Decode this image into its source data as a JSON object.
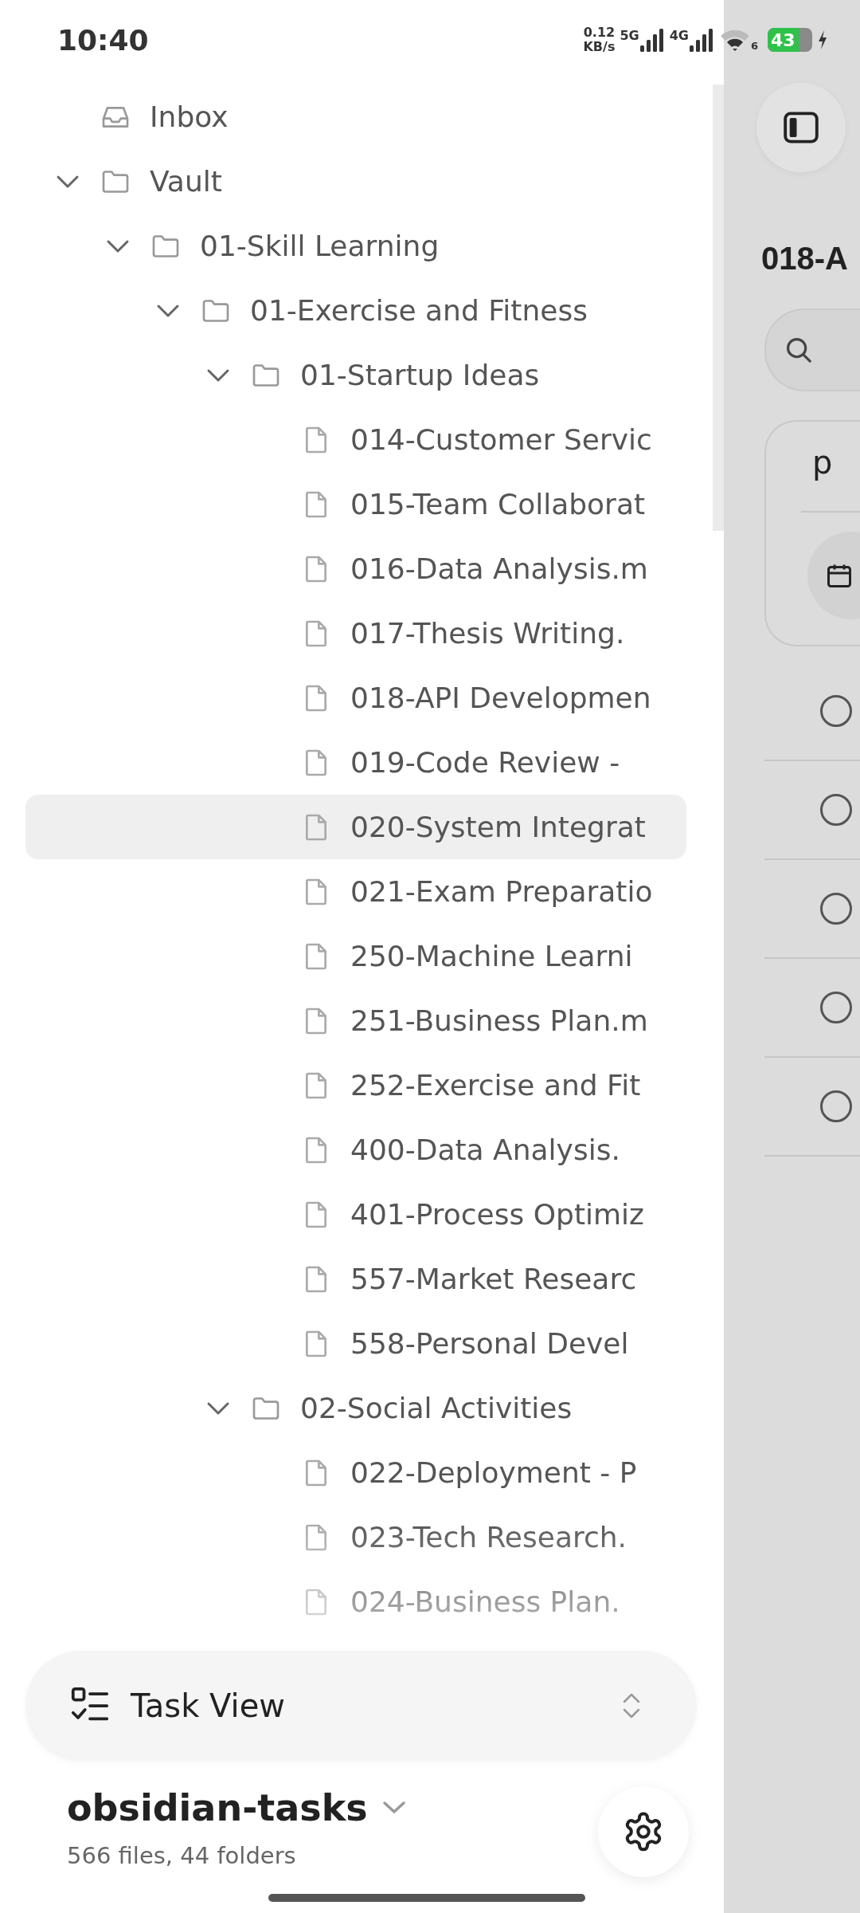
{
  "status_bar": {
    "time": "10:40",
    "net_speed": [
      "0.12",
      "KB/s"
    ],
    "sim_1": "5G",
    "sim_2": "4G",
    "wifi_badge": "6",
    "battery": "43",
    "charging": true
  },
  "tree": [
    {
      "kind": "inbox",
      "label": "Inbox",
      "selected": false
    },
    {
      "kind": "folder",
      "label": "Vault",
      "expanded": true,
      "selected": false,
      "children": [
        {
          "kind": "folder",
          "label": "01-Skill Learning",
          "expanded": true,
          "selected": false,
          "children": [
            {
              "kind": "folder",
              "label": "01-Exercise and Fitness",
              "expanded": true,
              "selected": false,
              "children": [
                {
                  "kind": "folder",
                  "label": "01-Startup Ideas",
                  "expanded": true,
                  "selected": false,
                  "children": [
                    {
                      "kind": "file",
                      "label": "014-Customer Servic",
                      "selected": false
                    },
                    {
                      "kind": "file",
                      "label": "015-Team Collaborat",
                      "selected": false
                    },
                    {
                      "kind": "file",
                      "label": "016-Data Analysis.m",
                      "selected": false
                    },
                    {
                      "kind": "file",
                      "label": "017-Thesis Writing.",
                      "selected": false
                    },
                    {
                      "kind": "file",
                      "label": "018-API Developmen",
                      "selected": false
                    },
                    {
                      "kind": "file",
                      "label": "019-Code Review -",
                      "selected": false
                    },
                    {
                      "kind": "file",
                      "label": "020-System Integrat",
                      "selected": true
                    },
                    {
                      "kind": "file",
                      "label": "021-Exam Preparatio",
                      "selected": false
                    },
                    {
                      "kind": "file",
                      "label": "250-Machine Learni",
                      "selected": false
                    },
                    {
                      "kind": "file",
                      "label": "251-Business Plan.m",
                      "selected": false
                    },
                    {
                      "kind": "file",
                      "label": "252-Exercise and Fit",
                      "selected": false
                    },
                    {
                      "kind": "file",
                      "label": "400-Data Analysis.",
                      "selected": false
                    },
                    {
                      "kind": "file",
                      "label": "401-Process Optimiz",
                      "selected": false
                    },
                    {
                      "kind": "file",
                      "label": "557-Market Researc",
                      "selected": false
                    },
                    {
                      "kind": "file",
                      "label": "558-Personal Devel",
                      "selected": false
                    }
                  ]
                },
                {
                  "kind": "folder",
                  "label": "02-Social Activities",
                  "expanded": true,
                  "selected": false,
                  "children": [
                    {
                      "kind": "file",
                      "label": "022-Deployment - P",
                      "selected": false
                    },
                    {
                      "kind": "file",
                      "label": "023-Tech Research.",
                      "selected": false
                    },
                    {
                      "kind": "file",
                      "label": "024-Business Plan.",
                      "selected": false
                    }
                  ]
                }
              ]
            }
          ]
        }
      ]
    }
  ],
  "view_switcher": {
    "label": "Task View"
  },
  "vault": {
    "name": "obsidian-tasks",
    "stats": "566 files, 44 folders"
  },
  "main_panel": {
    "title": "018-A",
    "editor_text": "p",
    "tasks": [
      {
        "checked": false
      },
      {
        "checked": false
      },
      {
        "checked": false
      },
      {
        "checked": false
      },
      {
        "checked": false
      }
    ]
  }
}
